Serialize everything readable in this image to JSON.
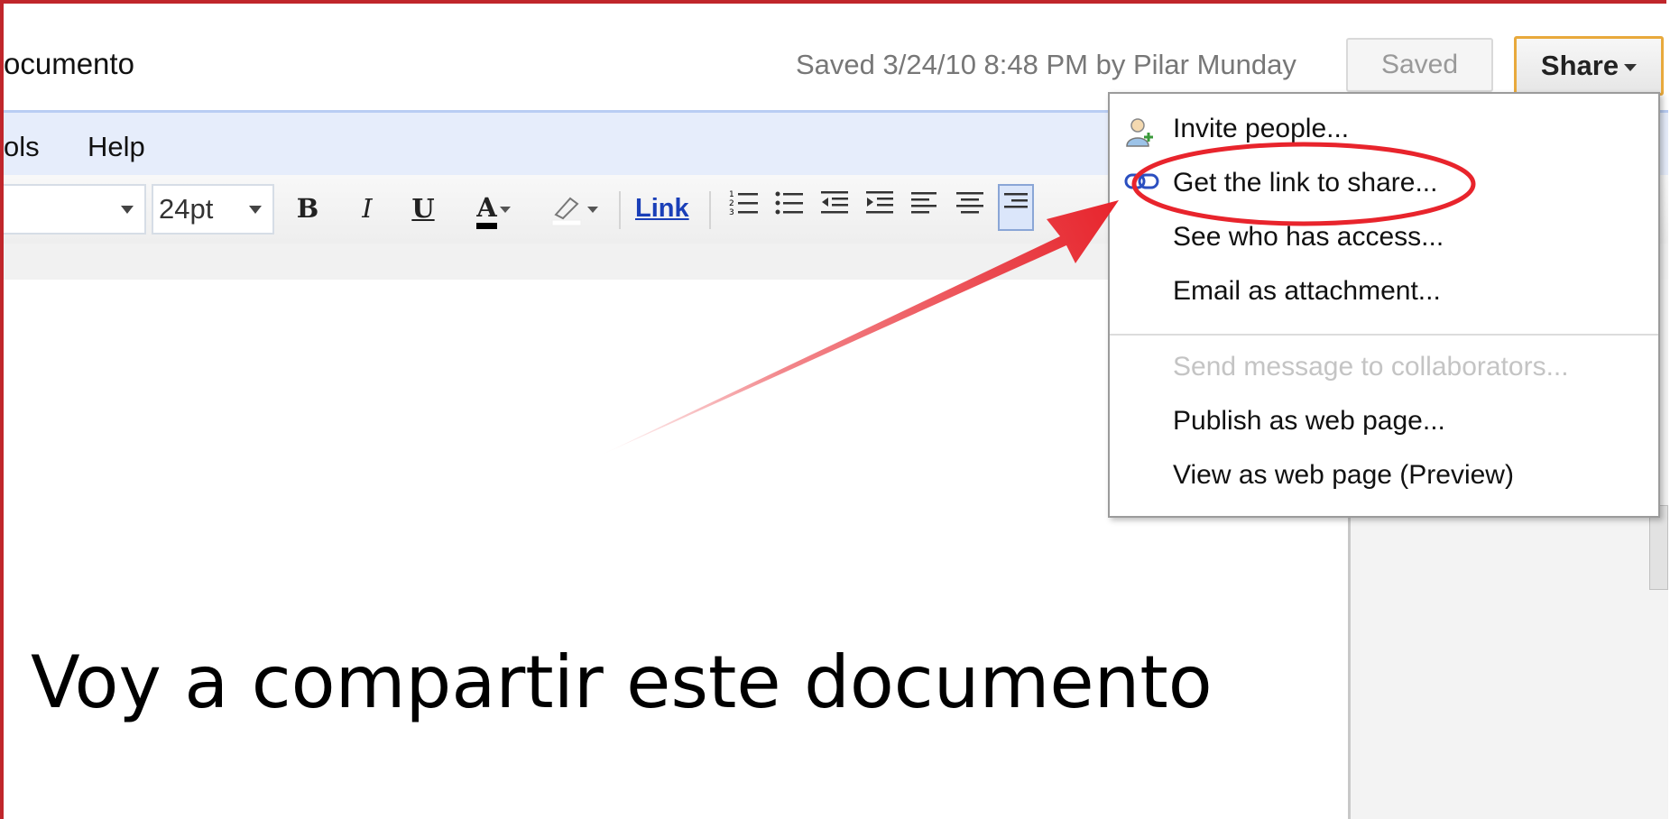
{
  "header": {
    "doc_title": "ocumento",
    "saved_status": "Saved 3/24/10 8:48 PM by Pilar Munday",
    "saved_button": "Saved",
    "share_button": "Share"
  },
  "menubar": {
    "items": [
      "ols",
      "Help"
    ]
  },
  "toolbar": {
    "font_size": "24pt",
    "bold": "B",
    "italic": "I",
    "underline": "U",
    "text_color": "A",
    "link": "Link"
  },
  "document": {
    "body_text": "Voy a compartir este documento"
  },
  "share_menu": {
    "items": [
      {
        "label": "Invite people...",
        "enabled": true
      },
      {
        "label": "Get the link to share...",
        "enabled": true
      },
      {
        "label": "See who has access...",
        "enabled": true
      },
      {
        "label": "Email as attachment...",
        "enabled": true
      },
      {
        "label": "Send message to collaborators...",
        "enabled": false
      },
      {
        "label": "Publish as web page...",
        "enabled": true
      },
      {
        "label": "View as web page (Preview)",
        "enabled": true
      }
    ]
  },
  "colors": {
    "frame_border": "#c0262b",
    "annotation_red": "#e8242c",
    "share_button_border": "#e8a93c",
    "menubar_bg": "#e6edfb",
    "link_color": "#1a3fb8"
  }
}
